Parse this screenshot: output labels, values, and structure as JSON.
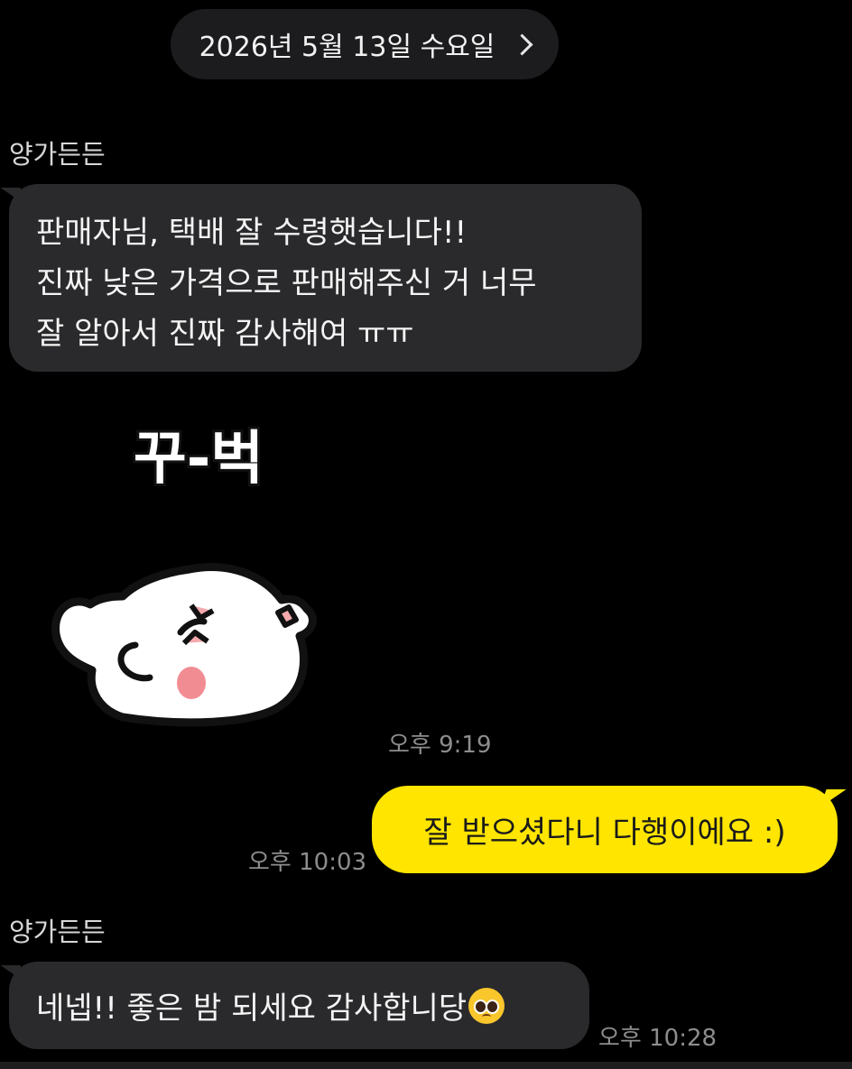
{
  "date_header": {
    "label": "2026년 5월 13일 수요일",
    "chevron_icon": "chevron-right-icon"
  },
  "messages": [
    {
      "sender": "양가든든",
      "lines": [
        "판매자님, 택배 잘 수령햇습니다!!",
        "진짜 낮은 가격으로 판매해주신 거 너무",
        "잘 알아서 진짜 감사해여 ㅠㅠ"
      ]
    },
    {
      "sticker_text": "꾸-벅",
      "sticker_icon": "bowing-ghost-sticker",
      "time": "오후 9:19"
    },
    {
      "outgoing": true,
      "text": "잘 받으셨다니 다행이에요 :)",
      "time": "오후 10:03"
    },
    {
      "sender": "양가든든",
      "text": "네넵!! 좋은 밤 되세요 감사합니당",
      "emoji_icon": "pleading-face-emoji",
      "time": "오후 10:28"
    }
  ],
  "colors": {
    "background": "#000000",
    "incoming_bubble": "#2a2a2c",
    "outgoing_bubble": "#ffe500",
    "time_text": "#8d8d8d"
  }
}
